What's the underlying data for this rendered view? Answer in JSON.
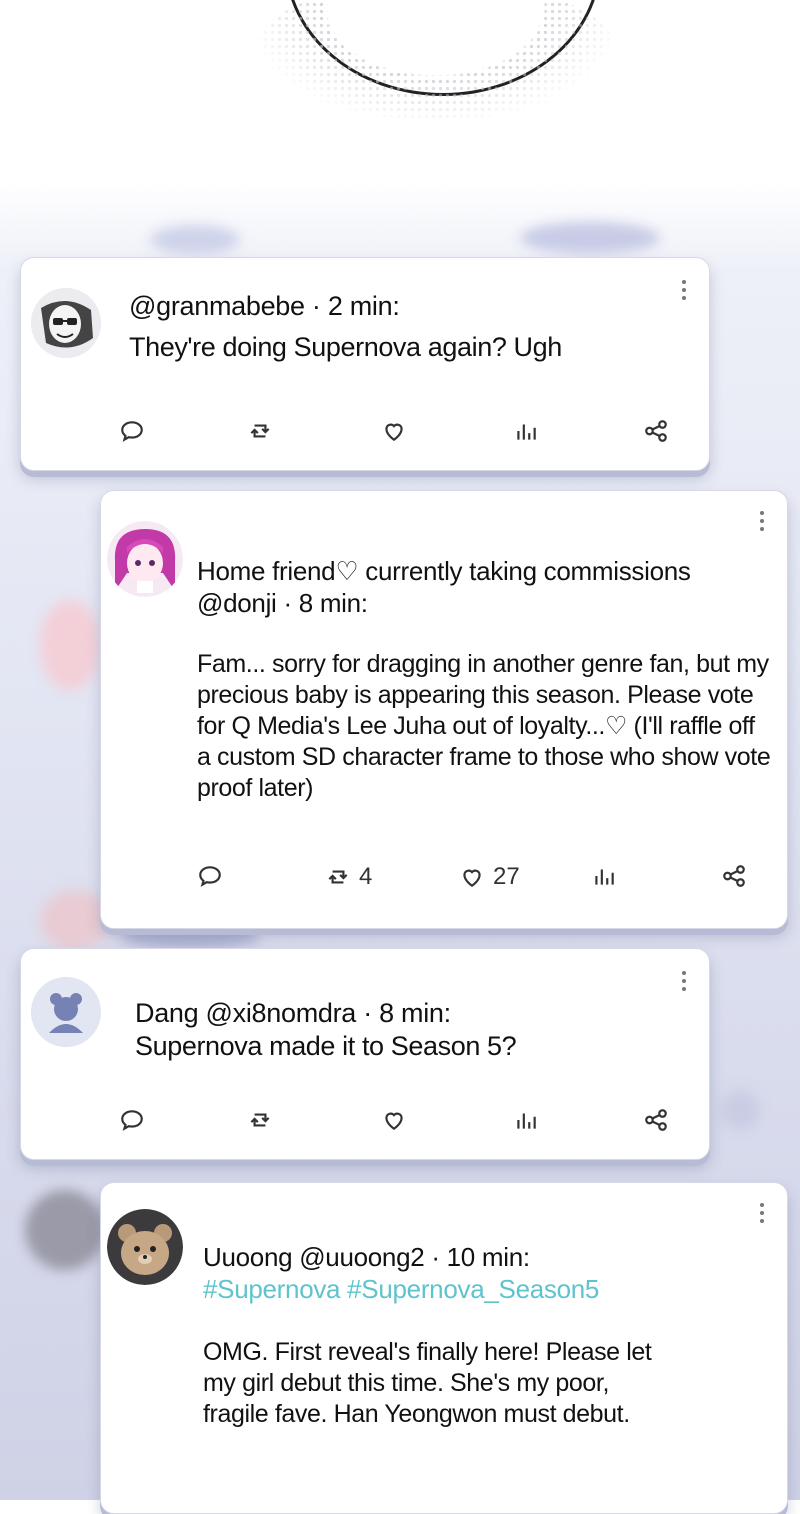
{
  "posts": [
    {
      "header": "@granmabebe · 2 min:",
      "body": "They're doing Supernova again? Ugh",
      "actions": {
        "retweets": "",
        "likes": ""
      }
    },
    {
      "display_name": "Home friend♡ currently taking commissions",
      "header": "@donji · 8 min:",
      "body": "Fam... sorry for dragging in another genre fan, but my precious baby is appearing this season. Please vote for Q Media's Lee Juha out of loyalty...♡ (I'll raffle off a custom SD character frame to those who show vote proof later)",
      "actions": {
        "retweets": "4",
        "likes": "27"
      }
    },
    {
      "header": "Dang @xi8nomdra · 8 min:",
      "body": "Supernova made it to Season 5?",
      "actions": {
        "retweets": "",
        "likes": ""
      }
    },
    {
      "header": "Uuoong @uuoong2 · 10 min:",
      "hashtags": "#Supernova #Supernova_Season5",
      "body": "OMG. First reveal's finally here! Please let my girl debut this time. She's my poor, fragile fave. Han Yeongwon must debut."
    }
  ],
  "icons": {
    "reply": "comment-icon",
    "retweet": "retweet-icon",
    "like": "heart-icon",
    "stats": "stats-icon",
    "share": "share-icon",
    "more": "more-vertical-icon"
  },
  "colors": {
    "hashtag": "#5fc3cf",
    "card_shadow": "#b7bbd6"
  }
}
